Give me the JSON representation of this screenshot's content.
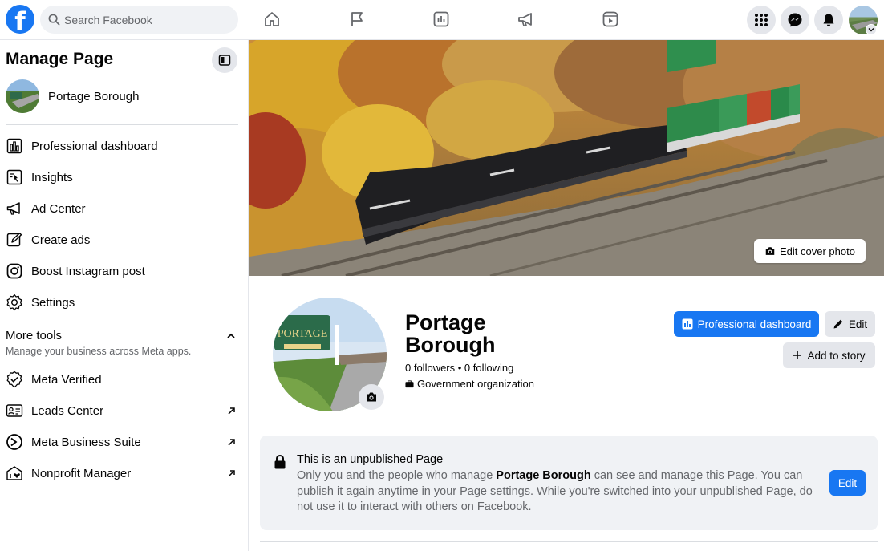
{
  "topbar": {
    "logo": "facebook-logo",
    "search_placeholder": "Search Facebook",
    "nav_icons": [
      "home-icon",
      "flag-icon",
      "dashboard-icon",
      "megaphone-icon",
      "video-icon"
    ],
    "right_icons": [
      "menu-grid-icon",
      "messenger-icon",
      "bell-icon",
      "account-avatar"
    ]
  },
  "sidebar": {
    "title": "Manage Page",
    "page_name": "Portage Borough",
    "items": [
      {
        "label": "Professional dashboard",
        "icon": "dashboard-icon"
      },
      {
        "label": "Insights",
        "icon": "insights-icon"
      },
      {
        "label": "Ad Center",
        "icon": "megaphone-icon"
      },
      {
        "label": "Create ads",
        "icon": "pencil-icon"
      },
      {
        "label": "Boost Instagram post",
        "icon": "instagram-icon"
      },
      {
        "label": "Settings",
        "icon": "gear-icon"
      }
    ],
    "more_tools": {
      "title": "More tools",
      "subtitle": "Manage your business across Meta apps.",
      "items": [
        {
          "label": "Meta Verified",
          "icon": "verified-badge-icon",
          "external": false
        },
        {
          "label": "Leads Center",
          "icon": "contact-card-icon",
          "external": true
        },
        {
          "label": "Meta Business Suite",
          "icon": "business-suite-icon",
          "external": true
        },
        {
          "label": "Nonprofit Manager",
          "icon": "nonprofit-icon",
          "external": true
        }
      ]
    }
  },
  "cover": {
    "edit_label": "Edit cover photo"
  },
  "profile": {
    "name": "Portage Borough",
    "stats": "0 followers • 0 following",
    "category": "Government organization",
    "buttons": {
      "dashboard": "Professional dashboard",
      "edit": "Edit",
      "add_story": "Add to story"
    }
  },
  "notice": {
    "title": "This is an unpublished Page",
    "body_pre": "Only you and the people who manage ",
    "body_bold": "Portage Borough",
    "body_post": " can see and manage this Page. You can publish it again anytime in your Page settings. While you're switched into your unpublished Page, do not use it to interact with others on Facebook.",
    "edit_label": "Edit"
  },
  "colors": {
    "accent": "#1877f2",
    "grey_button": "#e4e6eb",
    "notice_bg": "#f0f2f5",
    "secondary_text": "#65676b"
  }
}
